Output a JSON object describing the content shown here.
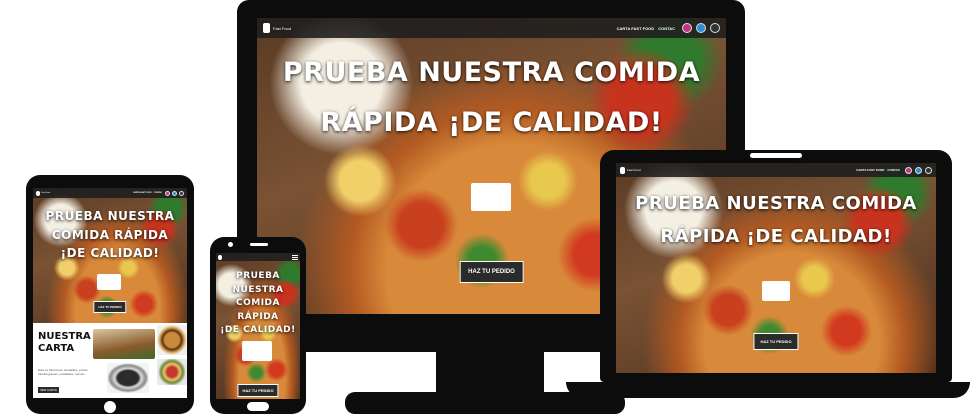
{
  "brand": {
    "name": "Fast Food"
  },
  "nav": {
    "link_carta": "CARTA FAST FOOD",
    "link_contact": "CONTACT",
    "link_contact_short": "CONTAC"
  },
  "social_icons": [
    "instagram-icon",
    "twitter-icon",
    "github-icon"
  ],
  "hero": {
    "line1": "PRUEBA NUESTRA COMIDA",
    "line2": "RÁPIDA ¡DE CALIDAD!",
    "tablet_line1": "PRUEBA NUESTRA",
    "tablet_line2": "COMIDA RÁPIDA",
    "tablet_line3": "¡DE CALIDAD!",
    "phone_line1": "PRUEBA",
    "phone_line2": "NUESTRA",
    "phone_line3": "COMIDA RÁPIDA",
    "phone_line4": "¡DE CALIDAD!",
    "cta_label": "HAZ TU PEDIDO"
  },
  "menu_section": {
    "title_line1": "NUESTRA",
    "title_line2": "CARTA",
    "text": "Esta es Fast Food, bocadillos, pizzas, hamburguesas, ensaladas, menus...",
    "button": "VER CARTA"
  },
  "colors": {
    "navbar": "#1e1e1e",
    "cta_bg": "#2b2b2b",
    "frame": "#0c0c0c",
    "instagram": "#c13584",
    "twitter": "#2d8fd6",
    "github": "#333333"
  }
}
